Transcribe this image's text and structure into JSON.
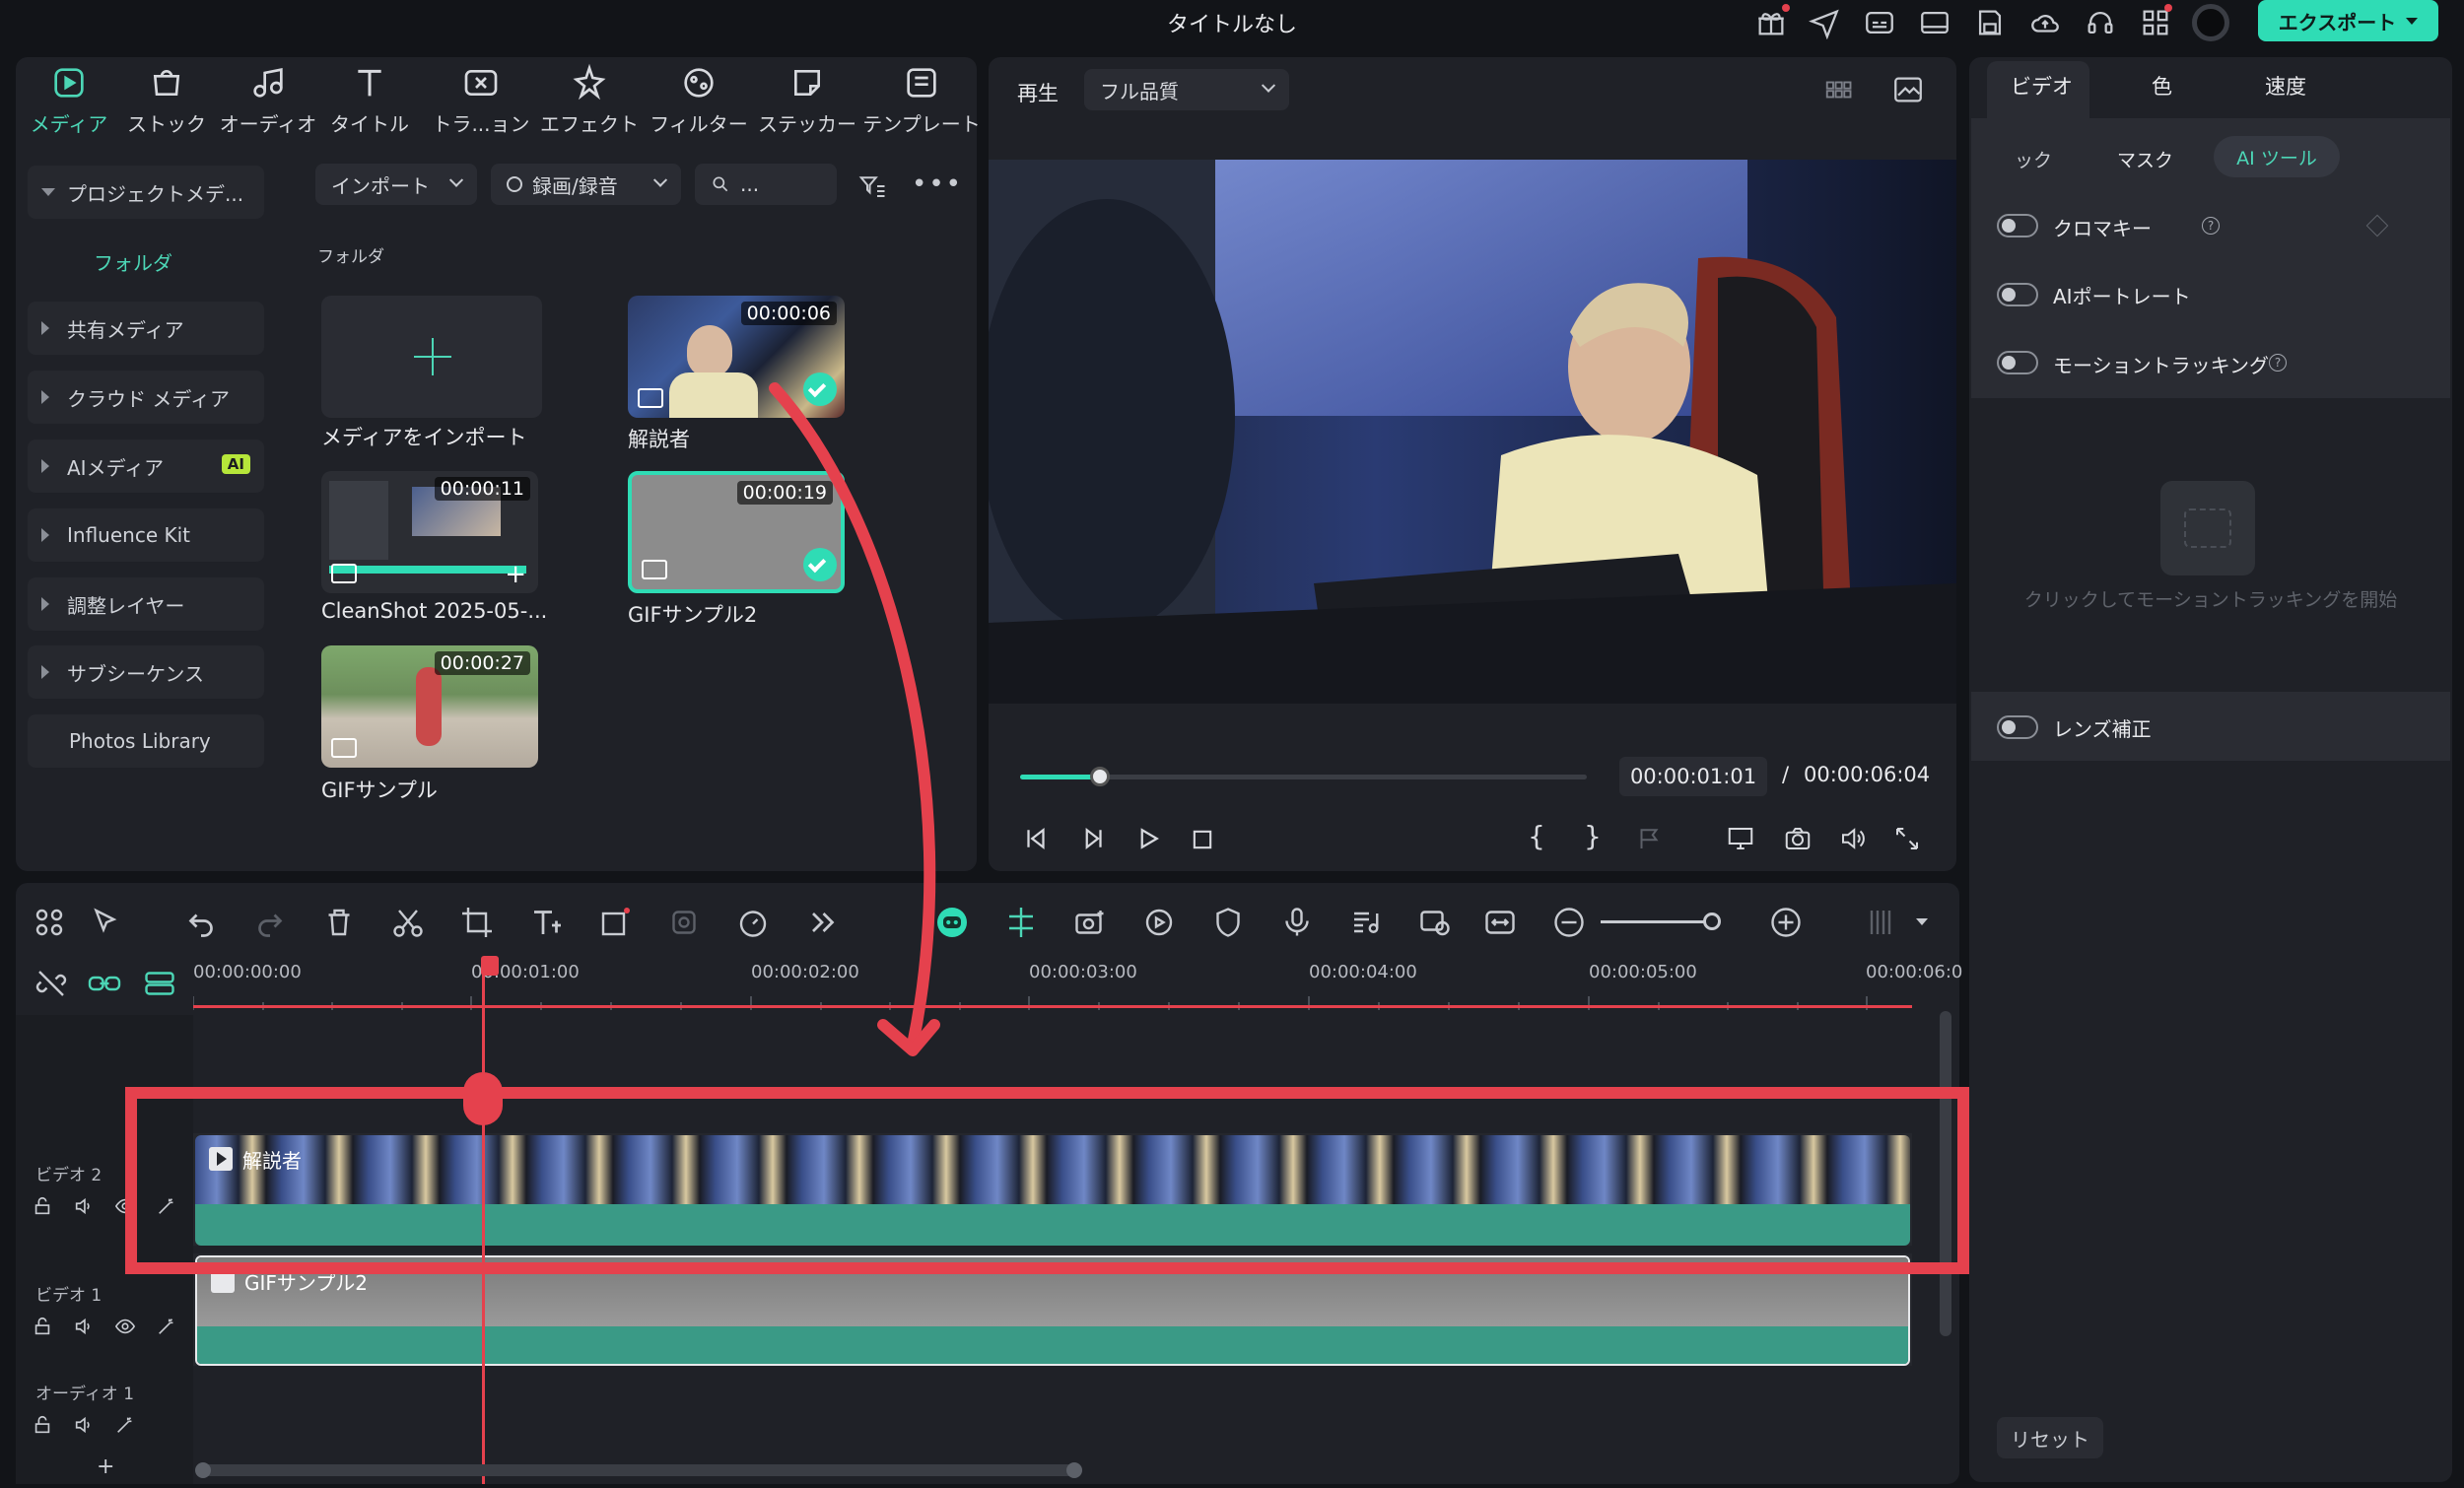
{
  "window": {
    "title": "タイトルなし",
    "export_label": "エクスポート"
  },
  "media_tabs": [
    {
      "label": "メディア",
      "icon": "media-icon",
      "active": true
    },
    {
      "label": "ストック",
      "icon": "stock-icon"
    },
    {
      "label": "オーディオ",
      "icon": "music-note-icon"
    },
    {
      "label": "タイトル",
      "icon": "text-icon"
    },
    {
      "label": "トラ...ョン",
      "icon": "transition-icon"
    },
    {
      "label": "エフェクト",
      "icon": "effects-icon"
    },
    {
      "label": "フィルター",
      "icon": "filter-icon"
    },
    {
      "label": "ステッカー",
      "icon": "sticker-icon"
    },
    {
      "label": "テンプレート",
      "icon": "template-icon"
    }
  ],
  "sidebar": {
    "project_media": "プロジェクトメデ...",
    "folder": "フォルダ",
    "items": [
      {
        "label": "共有メディア"
      },
      {
        "label": "クラウド メディア"
      },
      {
        "label": "AIメディア",
        "badge": "AI"
      },
      {
        "label": "Influence Kit"
      },
      {
        "label": "調整レイヤー"
      },
      {
        "label": "サブシーケンス"
      }
    ],
    "photos_library": "Photos Library"
  },
  "media_toolbar": {
    "import": "インポート",
    "record": "録画/録音",
    "search_placeholder": "..."
  },
  "media_grid": {
    "section_title": "フォルダ",
    "import_label": "メディアをインポート",
    "items": [
      {
        "name": "解説者",
        "duration": "00:00:06"
      },
      {
        "name": "CleanShot 2025-05-...",
        "duration": "00:00:11"
      },
      {
        "name": "GIFサンプル2",
        "duration": "00:00:19"
      },
      {
        "name": "GIFサンプル",
        "duration": "00:00:27"
      }
    ]
  },
  "preview": {
    "label": "再生",
    "quality": "フル品質",
    "current_time": "00:00:01:01",
    "separator": "/",
    "total_time": "00:00:06:04",
    "progress": 0.14
  },
  "right_panel": {
    "tabs": [
      "ビデオ",
      "色",
      "速度"
    ],
    "subtabs": [
      "ック",
      "マスク",
      "AI ツール"
    ],
    "options": [
      "クロマキー",
      "AIポートレート",
      "モーショントラッキング"
    ],
    "tracking_hint": "クリックしてモーショントラッキングを開始",
    "lens": "レンズ補正",
    "reset": "リセット"
  },
  "timeline": {
    "ruler": [
      "00:00:00:00",
      "00:00:01:00",
      "00:00:02:00",
      "00:00:03:00",
      "00:00:04:00",
      "00:00:05:00",
      "00:00:06:0"
    ],
    "tracks": [
      {
        "label": "ビデオ 2",
        "clip": "解説者"
      },
      {
        "label": "ビデオ 1",
        "clip": "GIFサンプル2"
      },
      {
        "label": "オーディオ 1"
      }
    ],
    "add_track": "+"
  },
  "colors": {
    "accent": "#2fdcb5",
    "highlight": "#e5414d",
    "panel": "#1f2127"
  }
}
